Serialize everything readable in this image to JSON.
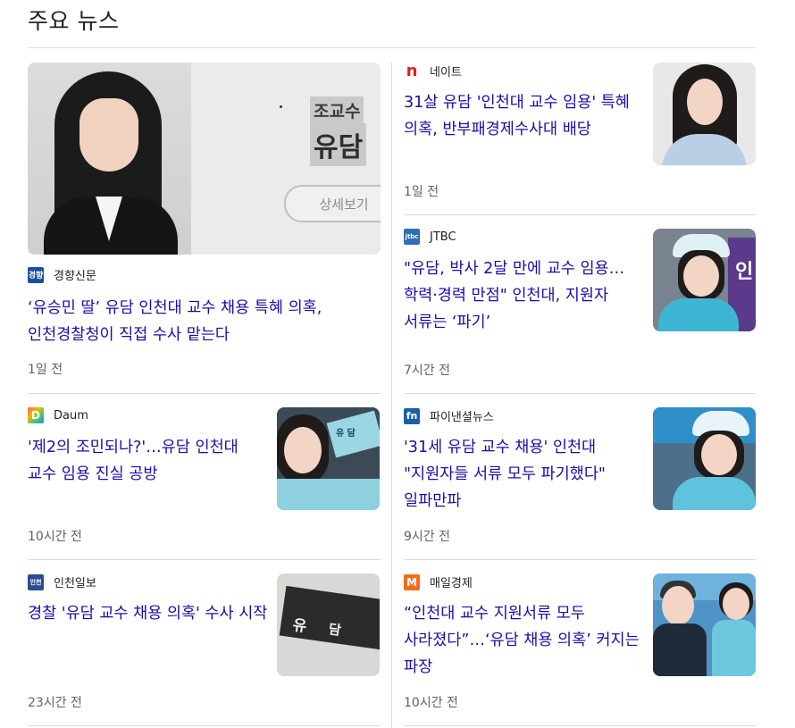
{
  "section_title": "주요 뉴스",
  "featured_image": {
    "highlight_small": "조교수",
    "highlight_large": "유담",
    "button": "상세보기"
  },
  "articles": [
    {
      "source": "경향신문",
      "logo_text": "경향",
      "headline": "‘유승민 딸’ 유담 인천대 교수 채용 특혜 의혹, 인천경찰청이 직접 수사 맡는다",
      "time": "1일 전"
    },
    {
      "source": "네이트",
      "logo_text": "n",
      "headline": "31살 유담 '인천대 교수 임용' 특혜 의혹, 반부패경제수사대 배당",
      "time": "1일 전"
    },
    {
      "source": "JTBC",
      "logo_text": "jtbc",
      "headline": "\"유담, 박사 2달 만에 교수 임용…학력·경력 만점\" 인천대, 지원자 서류는 ‘파기’",
      "time": "7시간 전"
    },
    {
      "source": "Daum",
      "logo_text": "D",
      "headline": "'제2의 조민되나?'…유담 인천대 교수 임용 진실 공방",
      "time": "10시간 전"
    },
    {
      "source": "파이낸셜뉴스",
      "logo_text": "fn",
      "headline": "'31세 유담 교수 채용' 인천대 \"지원자들 서류 모두 파기했다\" 일파만파",
      "time": "9시간 전"
    },
    {
      "source": "인천일보",
      "logo_text": "인천",
      "headline": "경찰 '유담 교수 채용 의혹' 수사 시작",
      "time": "23시간 전"
    },
    {
      "source": "매일경제",
      "logo_text": "M",
      "headline": "“인천대 교수 지원서류 모두 사라졌다”…‘유담 채용 의혹’ 커지는 파장",
      "time": "10시간 전"
    }
  ],
  "thumb_texts": {
    "daum_sign": "유 담",
    "incheon_sign_1": "유",
    "incheon_sign_2": "담",
    "jtbc_sign": "인"
  },
  "colors": {
    "headline": "#1a0dab",
    "meta": "#5f6368",
    "divider": "#dadce0"
  }
}
